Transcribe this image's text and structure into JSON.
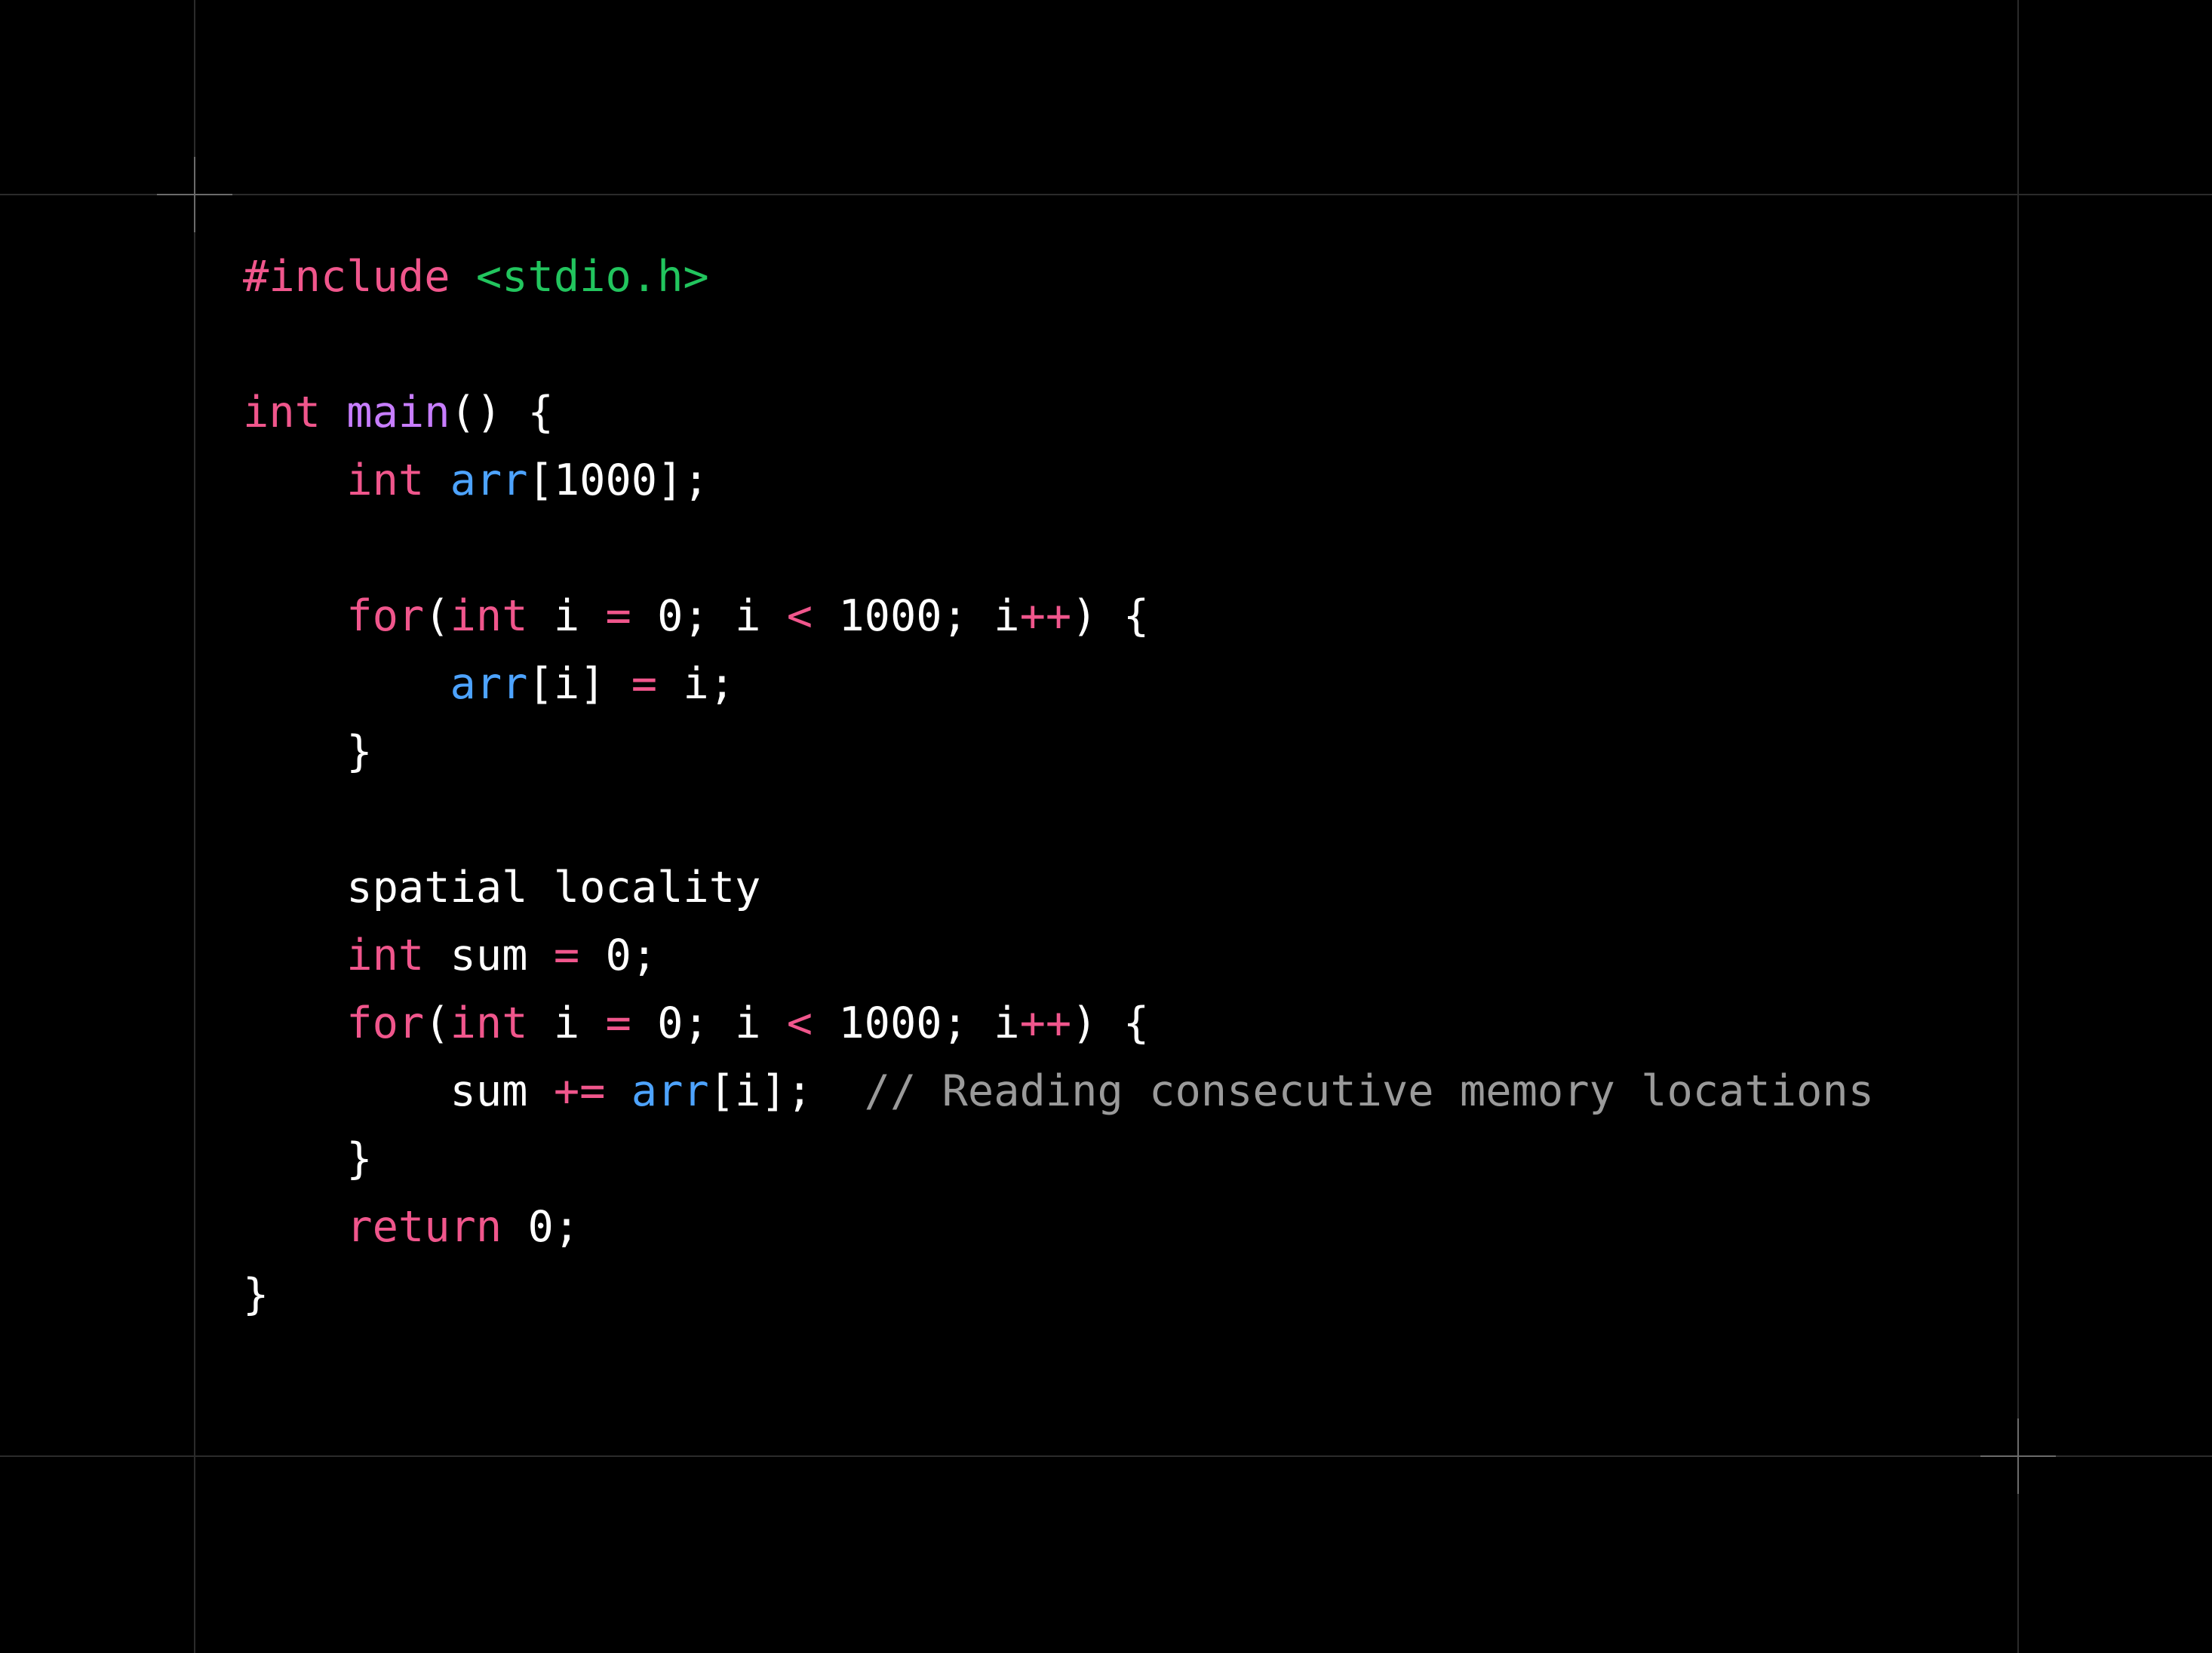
{
  "colors": {
    "background": "#000000",
    "default": "#ffffff",
    "keyword": "#f0568c",
    "string": "#22c55e",
    "function": "#c77dff",
    "variable": "#4da3ff",
    "comment": "#9a9a9a",
    "grid": "#2b2b2b",
    "crosshair": "#6b6b6b"
  },
  "code": {
    "language": "c",
    "lines": [
      [
        {
          "t": "#include",
          "c": "keyword"
        },
        {
          "t": " ",
          "c": "default"
        },
        {
          "t": "<stdio.h>",
          "c": "string"
        }
      ],
      [],
      [
        {
          "t": "int",
          "c": "keyword"
        },
        {
          "t": " ",
          "c": "default"
        },
        {
          "t": "main",
          "c": "function"
        },
        {
          "t": "() {",
          "c": "default"
        }
      ],
      [
        {
          "t": "    ",
          "c": "default"
        },
        {
          "t": "int",
          "c": "keyword"
        },
        {
          "t": " ",
          "c": "default"
        },
        {
          "t": "arr",
          "c": "variable"
        },
        {
          "t": "[1000];",
          "c": "default"
        }
      ],
      [],
      [
        {
          "t": "    ",
          "c": "default"
        },
        {
          "t": "for",
          "c": "keyword"
        },
        {
          "t": "(",
          "c": "default"
        },
        {
          "t": "int",
          "c": "keyword"
        },
        {
          "t": " i ",
          "c": "default"
        },
        {
          "t": "=",
          "c": "keyword"
        },
        {
          "t": " 0; i ",
          "c": "default"
        },
        {
          "t": "<",
          "c": "keyword"
        },
        {
          "t": " 1000; i",
          "c": "default"
        },
        {
          "t": "++",
          "c": "keyword"
        },
        {
          "t": ") {",
          "c": "default"
        }
      ],
      [
        {
          "t": "        ",
          "c": "default"
        },
        {
          "t": "arr",
          "c": "variable"
        },
        {
          "t": "[i] ",
          "c": "default"
        },
        {
          "t": "=",
          "c": "keyword"
        },
        {
          "t": " i;",
          "c": "default"
        }
      ],
      [
        {
          "t": "    }",
          "c": "default"
        }
      ],
      [],
      [
        {
          "t": "    spatial locality",
          "c": "default"
        }
      ],
      [
        {
          "t": "    ",
          "c": "default"
        },
        {
          "t": "int",
          "c": "keyword"
        },
        {
          "t": " sum ",
          "c": "default"
        },
        {
          "t": "=",
          "c": "keyword"
        },
        {
          "t": " 0;",
          "c": "default"
        }
      ],
      [
        {
          "t": "    ",
          "c": "default"
        },
        {
          "t": "for",
          "c": "keyword"
        },
        {
          "t": "(",
          "c": "default"
        },
        {
          "t": "int",
          "c": "keyword"
        },
        {
          "t": " i ",
          "c": "default"
        },
        {
          "t": "=",
          "c": "keyword"
        },
        {
          "t": " 0; i ",
          "c": "default"
        },
        {
          "t": "<",
          "c": "keyword"
        },
        {
          "t": " 1000; i",
          "c": "default"
        },
        {
          "t": "++",
          "c": "keyword"
        },
        {
          "t": ") {",
          "c": "default"
        }
      ],
      [
        {
          "t": "        sum ",
          "c": "default"
        },
        {
          "t": "+=",
          "c": "keyword"
        },
        {
          "t": " ",
          "c": "default"
        },
        {
          "t": "arr",
          "c": "variable"
        },
        {
          "t": "[i];  ",
          "c": "default"
        },
        {
          "t": "// Reading consecutive memory locations",
          "c": "comment"
        }
      ],
      [
        {
          "t": "    }",
          "c": "default"
        }
      ],
      [
        {
          "t": "    ",
          "c": "default"
        },
        {
          "t": "return",
          "c": "keyword"
        },
        {
          "t": " 0;",
          "c": "default"
        }
      ],
      [
        {
          "t": "}",
          "c": "default"
        }
      ]
    ]
  }
}
